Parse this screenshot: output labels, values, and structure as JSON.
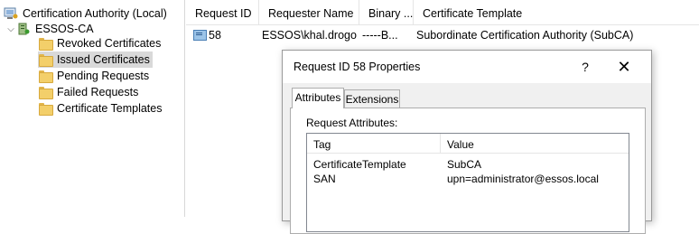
{
  "tree": {
    "root_label": "Certification Authority (Local)",
    "ca_label": "ESSOS-CA",
    "folders": [
      {
        "label": "Revoked Certificates"
      },
      {
        "label": "Issued Certificates",
        "selected": true
      },
      {
        "label": "Pending Requests"
      },
      {
        "label": "Failed Requests"
      },
      {
        "label": "Certificate Templates"
      }
    ]
  },
  "list": {
    "columns": [
      "Request ID",
      "Requester Name",
      "Binary ...",
      "Certificate Template"
    ],
    "rows": [
      {
        "request_id": "58",
        "requester_name": "ESSOS\\khal.drogo",
        "binary": "-----B...",
        "certificate_template": "Subordinate Certification Authority (SubCA)"
      }
    ]
  },
  "dialog": {
    "title": "Request ID 58 Properties",
    "help_label": "?",
    "close_label": "✕",
    "tabs": [
      "Attributes",
      "Extensions"
    ],
    "active_tab": "Attributes",
    "section_label": "Request Attributes:",
    "attr_columns": [
      "Tag",
      "Value"
    ],
    "attributes": [
      {
        "tag": "CertificateTemplate",
        "value": "SubCA"
      },
      {
        "tag": "SAN",
        "value": "upn=administrator@essos.local"
      }
    ]
  },
  "icons": {
    "root": "computer-certificate-icon",
    "ca": "ca-server-icon",
    "folder": "folder-icon",
    "certificate": "certificate-icon"
  }
}
